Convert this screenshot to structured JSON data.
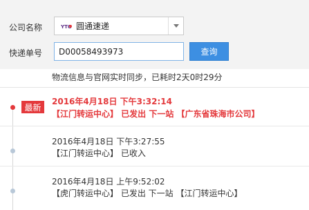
{
  "form": {
    "company_label": "公司名称",
    "company_value": "圆通速递",
    "company_logo": "yto-logo-icon",
    "number_label": "快递单号",
    "number_value": "D00058493973",
    "query_label": "查询"
  },
  "notice": "物流信息与官网实时同步，已耗时2天0时29分",
  "latest_badge": "最新",
  "colors": {
    "accent": "#3d8fe2",
    "latest": "#e4393c",
    "panel_bg": "#f3f3f3"
  },
  "entries": [
    {
      "time": "2016年4月18日 下午3:32:14",
      "desc": "【江门转运中心】 已发出 下一站 【广东省珠海市公司】"
    },
    {
      "time": "2016年4月18日 下午3:27:55",
      "desc": "【江门转运中心】 已收入"
    },
    {
      "time": "2016年4月18日 上午9:52:02",
      "desc": "【虎门转运中心】 已发出 下一站 【江门转运中心】"
    }
  ]
}
